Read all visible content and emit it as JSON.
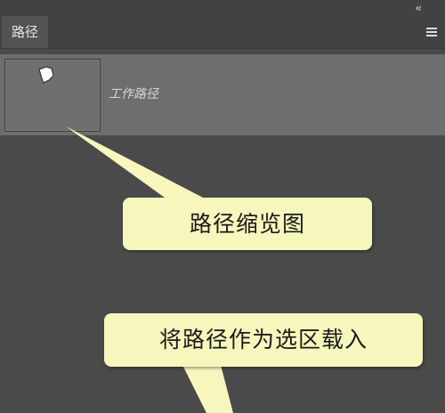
{
  "panel": {
    "collapse_glyph": "‹‹",
    "tab_label": "路径",
    "menu_icon": "hamburger-menu-icon"
  },
  "paths": [
    {
      "name": "工作路径",
      "thumbnail_icon": "path-shape-thumbnail"
    }
  ],
  "callouts": {
    "thumbnail": "路径缩览图",
    "load_selection": "将路径作为选区载入"
  },
  "colors": {
    "panel_bg": "#4a4a4a",
    "selected_row": "#6e6e6e",
    "callout_bg": "#f7f7bd"
  }
}
